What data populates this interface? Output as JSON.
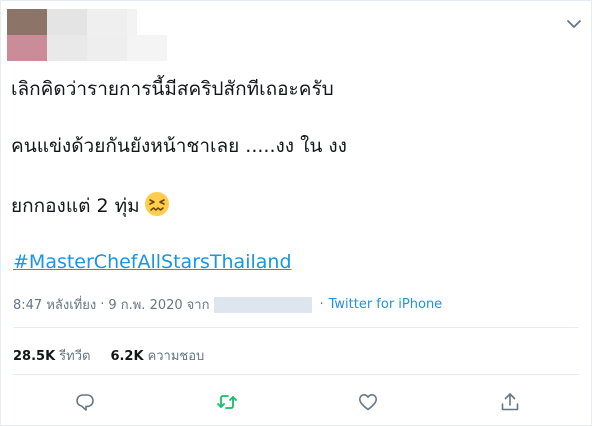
{
  "tweet": {
    "lines": [
      "เลิกคิดว่ารายการนี้มีสคริปสักทีเถอะครับ",
      "คนแข่งด้วยกันยังหน้าชาเลย .....งง ใน งง",
      "ยกกองแต่ 2 ทุ่ม"
    ],
    "emoji": "confounded-face",
    "hashtag": "#MasterChefAllStarsThailand",
    "time": "8:47 หลังเที่ยง",
    "separator": "·",
    "date": "9 ก.พ. 2020",
    "from_label": "จาก",
    "source": "Twitter for iPhone"
  },
  "stats": {
    "retweets_count": "28.5K",
    "retweets_label": "รีทวีต",
    "likes_count": "6.2K",
    "likes_label": "ความชอบ"
  },
  "icons": {
    "menu": "chevron-down-icon",
    "reply": "reply-icon",
    "retweet": "retweet-icon",
    "like": "heart-icon",
    "share": "share-icon"
  },
  "colors": {
    "link": "#1b95e0",
    "muted": "#657786",
    "retweet_active": "#17bf63",
    "text": "#14171a",
    "divider": "#e6ecf0"
  }
}
